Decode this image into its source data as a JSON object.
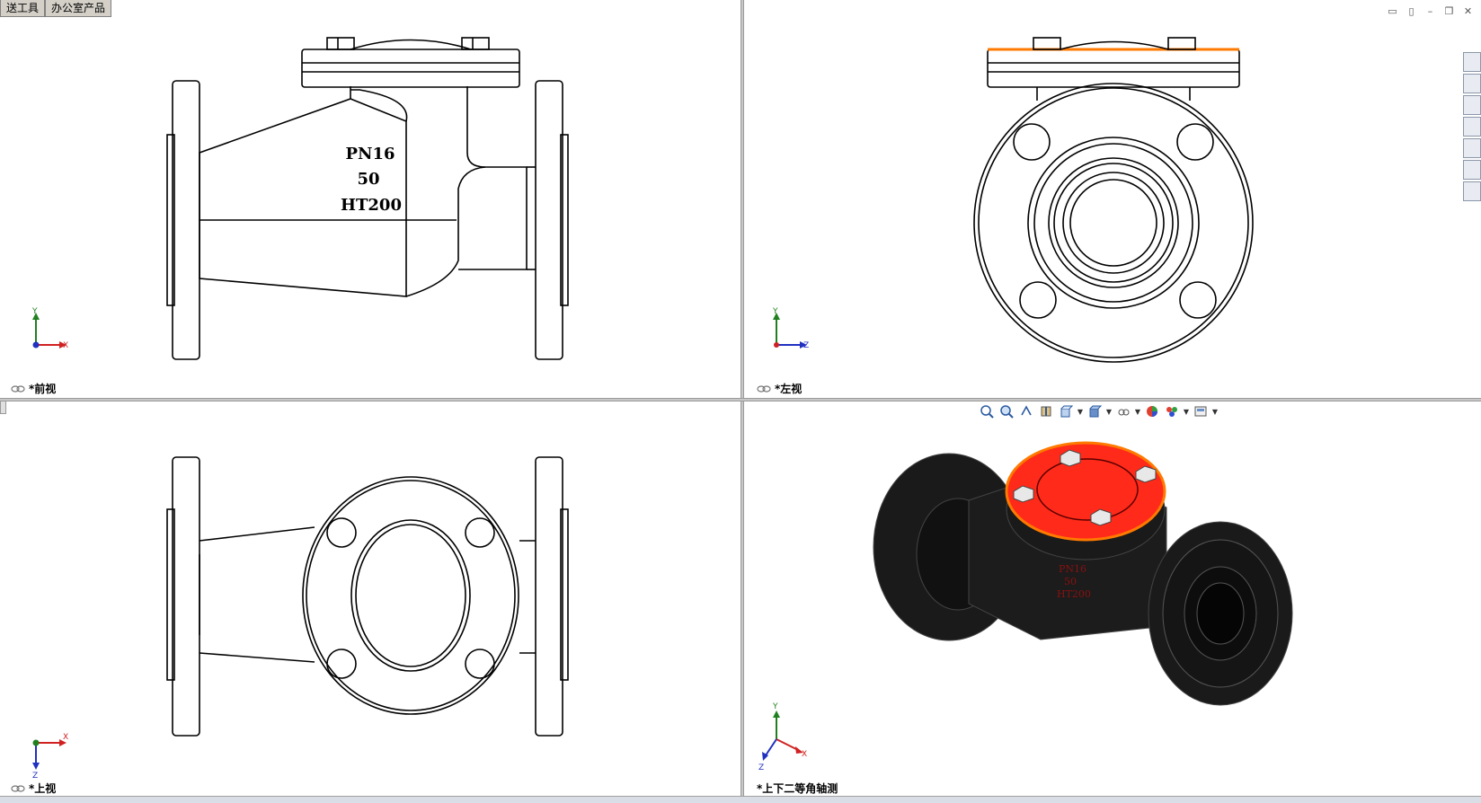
{
  "window": {
    "tabs": [
      {
        "label": "送工具"
      },
      {
        "label": "办公室产品"
      }
    ]
  },
  "viewports": {
    "front": {
      "label": "*前视",
      "axis": {
        "up": "Y",
        "right": "X"
      }
    },
    "left": {
      "label": "*左视",
      "axis": {
        "up": "Y",
        "right": "Z"
      }
    },
    "top": {
      "label": "*上视",
      "axis": {
        "down": "Z",
        "right": "X"
      }
    },
    "iso": {
      "label": "*上下二等角轴测",
      "axis": {
        "up": "Y",
        "right": "X",
        "down": "Z"
      }
    }
  },
  "part_markings": {
    "pressure": "PN16",
    "size": "50",
    "material": "HT200"
  },
  "colors": {
    "selected_face": "#ff2a1a",
    "selected_edge": "#ff7a00",
    "body": "#1a1a1a",
    "axis_x": "#d02020",
    "axis_y": "#208020",
    "axis_z": "#2030c0"
  },
  "window_controls": [
    {
      "icon": "tile-horizontal-icon"
    },
    {
      "icon": "tile-vertical-icon"
    },
    {
      "icon": "minimize-icon"
    },
    {
      "icon": "restore-icon"
    },
    {
      "icon": "close-icon"
    }
  ],
  "task_pane": [
    {
      "icon": "solidworks-resources-icon"
    },
    {
      "icon": "design-library-icon"
    },
    {
      "icon": "file-explorer-icon"
    },
    {
      "icon": "folder-icon"
    },
    {
      "icon": "view-palette-icon"
    },
    {
      "icon": "appearances-icon"
    },
    {
      "icon": "custom-properties-icon"
    }
  ],
  "heads_up_toolbar": [
    {
      "icon": "zoom-to-fit-icon"
    },
    {
      "icon": "zoom-to-area-icon"
    },
    {
      "icon": "previous-view-icon"
    },
    {
      "icon": "section-view-icon"
    },
    {
      "icon": "view-orientation-icon",
      "dropdown": true
    },
    {
      "icon": "display-style-icon",
      "dropdown": true
    },
    {
      "icon": "hide-show-items-icon",
      "dropdown": true
    },
    {
      "icon": "edit-appearance-icon"
    },
    {
      "icon": "apply-scene-icon",
      "dropdown": true
    },
    {
      "icon": "view-settings-icon",
      "dropdown": true
    }
  ]
}
